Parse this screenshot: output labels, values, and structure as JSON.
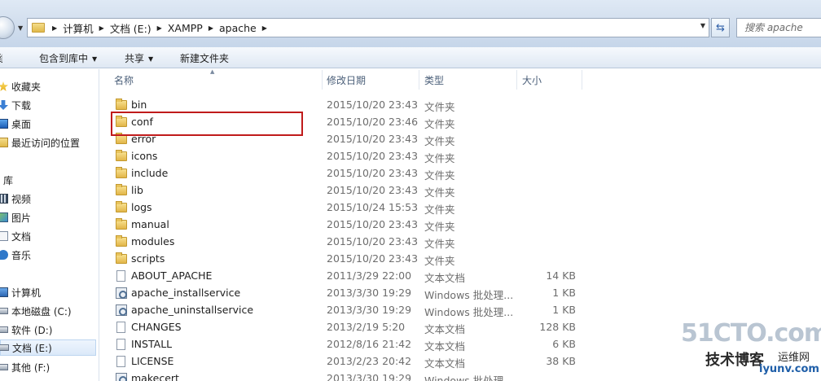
{
  "address_bar": {
    "crumbs": [
      "计算机",
      "文档 (E:)",
      "XAMPP",
      "apache"
    ],
    "search_placeholder": "搜索 apache"
  },
  "command_bar": {
    "partial_left": "组织",
    "items": [
      "包含到库中",
      "共享",
      "新建文件夹"
    ]
  },
  "nav_pane": {
    "favorites_header": "收藏夹",
    "favorites": [
      "下载",
      "桌面",
      "最近访问的位置"
    ],
    "libraries_header": "库",
    "libraries": [
      "视频",
      "图片",
      "文档",
      "音乐"
    ],
    "computer_header": "计算机",
    "drives": [
      "本地磁盘 (C:)",
      "软件 (D:)",
      "文档 (E:)",
      "其他 (F:)"
    ]
  },
  "columns": [
    "名称",
    "修改日期",
    "类型",
    "大小"
  ],
  "files": [
    {
      "name": "bin",
      "date": "2015/10/20 23:43",
      "type": "文件夹",
      "size": "",
      "icon": "folder"
    },
    {
      "name": "conf",
      "date": "2015/10/20 23:46",
      "type": "文件夹",
      "size": "",
      "icon": "folder"
    },
    {
      "name": "error",
      "date": "2015/10/20 23:43",
      "type": "文件夹",
      "size": "",
      "icon": "folder"
    },
    {
      "name": "icons",
      "date": "2015/10/20 23:43",
      "type": "文件夹",
      "size": "",
      "icon": "folder"
    },
    {
      "name": "include",
      "date": "2015/10/20 23:43",
      "type": "文件夹",
      "size": "",
      "icon": "folder"
    },
    {
      "name": "lib",
      "date": "2015/10/20 23:43",
      "type": "文件夹",
      "size": "",
      "icon": "folder"
    },
    {
      "name": "logs",
      "date": "2015/10/24 15:53",
      "type": "文件夹",
      "size": "",
      "icon": "folder"
    },
    {
      "name": "manual",
      "date": "2015/10/20 23:43",
      "type": "文件夹",
      "size": "",
      "icon": "folder"
    },
    {
      "name": "modules",
      "date": "2015/10/20 23:43",
      "type": "文件夹",
      "size": "",
      "icon": "folder"
    },
    {
      "name": "scripts",
      "date": "2015/10/20 23:43",
      "type": "文件夹",
      "size": "",
      "icon": "folder"
    },
    {
      "name": "ABOUT_APACHE",
      "date": "2011/3/29 22:00",
      "type": "文本文档",
      "size": "14 KB",
      "icon": "file"
    },
    {
      "name": "apache_installservice",
      "date": "2013/3/30 19:29",
      "type": "Windows 批处理...",
      "size": "1 KB",
      "icon": "bat"
    },
    {
      "name": "apache_uninstallservice",
      "date": "2013/3/30 19:29",
      "type": "Windows 批处理...",
      "size": "1 KB",
      "icon": "bat"
    },
    {
      "name": "CHANGES",
      "date": "2013/2/19 5:20",
      "type": "文本文档",
      "size": "128 KB",
      "icon": "file"
    },
    {
      "name": "INSTALL",
      "date": "2012/8/16 21:42",
      "type": "文本文档",
      "size": "6 KB",
      "icon": "file"
    },
    {
      "name": "LICENSE",
      "date": "2013/2/23 20:42",
      "type": "文本文档",
      "size": "38 KB",
      "icon": "file"
    },
    {
      "name": "makecert",
      "date": "2013/3/30 19:29",
      "type": "Windows 批处理...",
      "size": "",
      "icon": "bat"
    }
  ],
  "watermark": {
    "logo": "51CTO.com",
    "text1": "技术博客",
    "text2": "运维网",
    "url": "iyunv.com"
  }
}
